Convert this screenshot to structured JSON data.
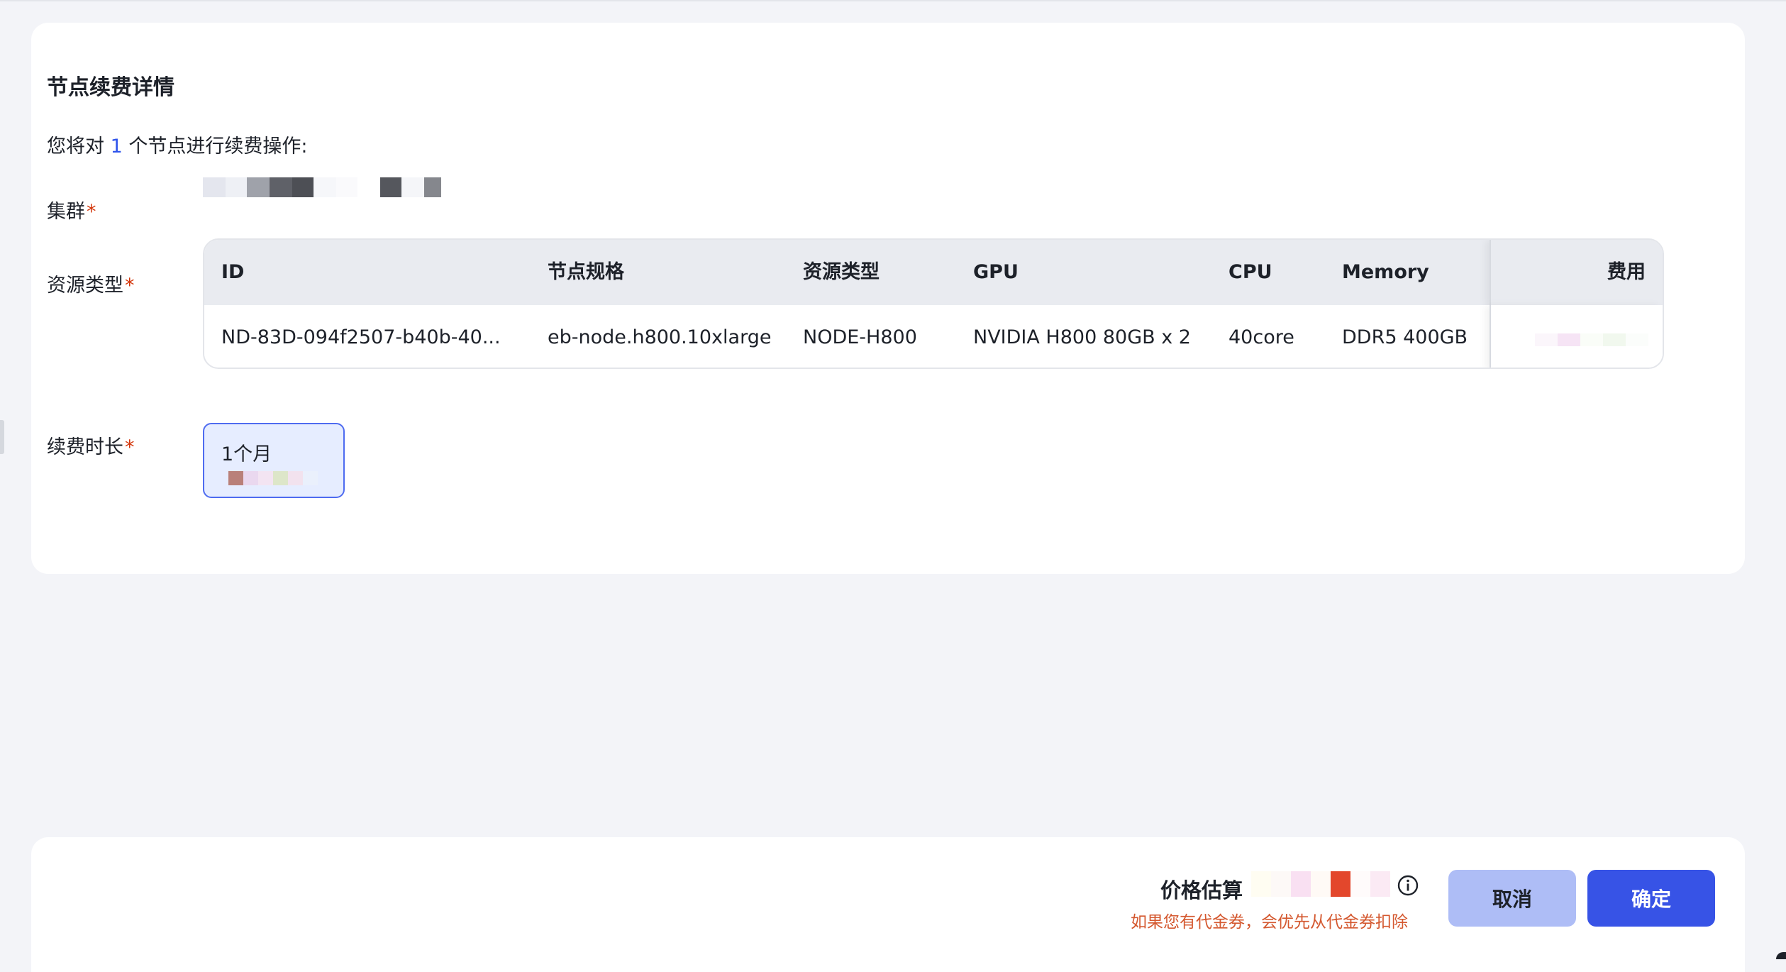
{
  "card": {
    "title": "节点续费详情",
    "intro_prefix": "您将对",
    "intro_count": "1",
    "intro_suffix": "个节点进行续费操作:"
  },
  "form": {
    "cluster_label": "集群",
    "resource_label": "资源类型",
    "duration_label": "续费时长",
    "required_mark": "*"
  },
  "table": {
    "columns": [
      "ID",
      "节点规格",
      "资源类型",
      "GPU",
      "CPU",
      "Memory",
      "费用"
    ],
    "rows": [
      {
        "id": "ND-83D-094f2507-b40b-40...",
        "spec": "eb-node.h800.10xlarge",
        "resource_type": "NODE-H800",
        "gpu": "NVIDIA H800 80GB x 2",
        "cpu": "40core",
        "memory": "DDR5 400GB"
      }
    ]
  },
  "duration": {
    "option_label": "1个月"
  },
  "footer": {
    "price_label": "价格估算",
    "voucher_note": "如果您有代金券，会优先从代金券扣除",
    "cancel_label": "取消",
    "confirm_label": "确定"
  },
  "colors": {
    "accent": "#3753e6",
    "required": "#d4380d",
    "note": "#d4582f"
  }
}
